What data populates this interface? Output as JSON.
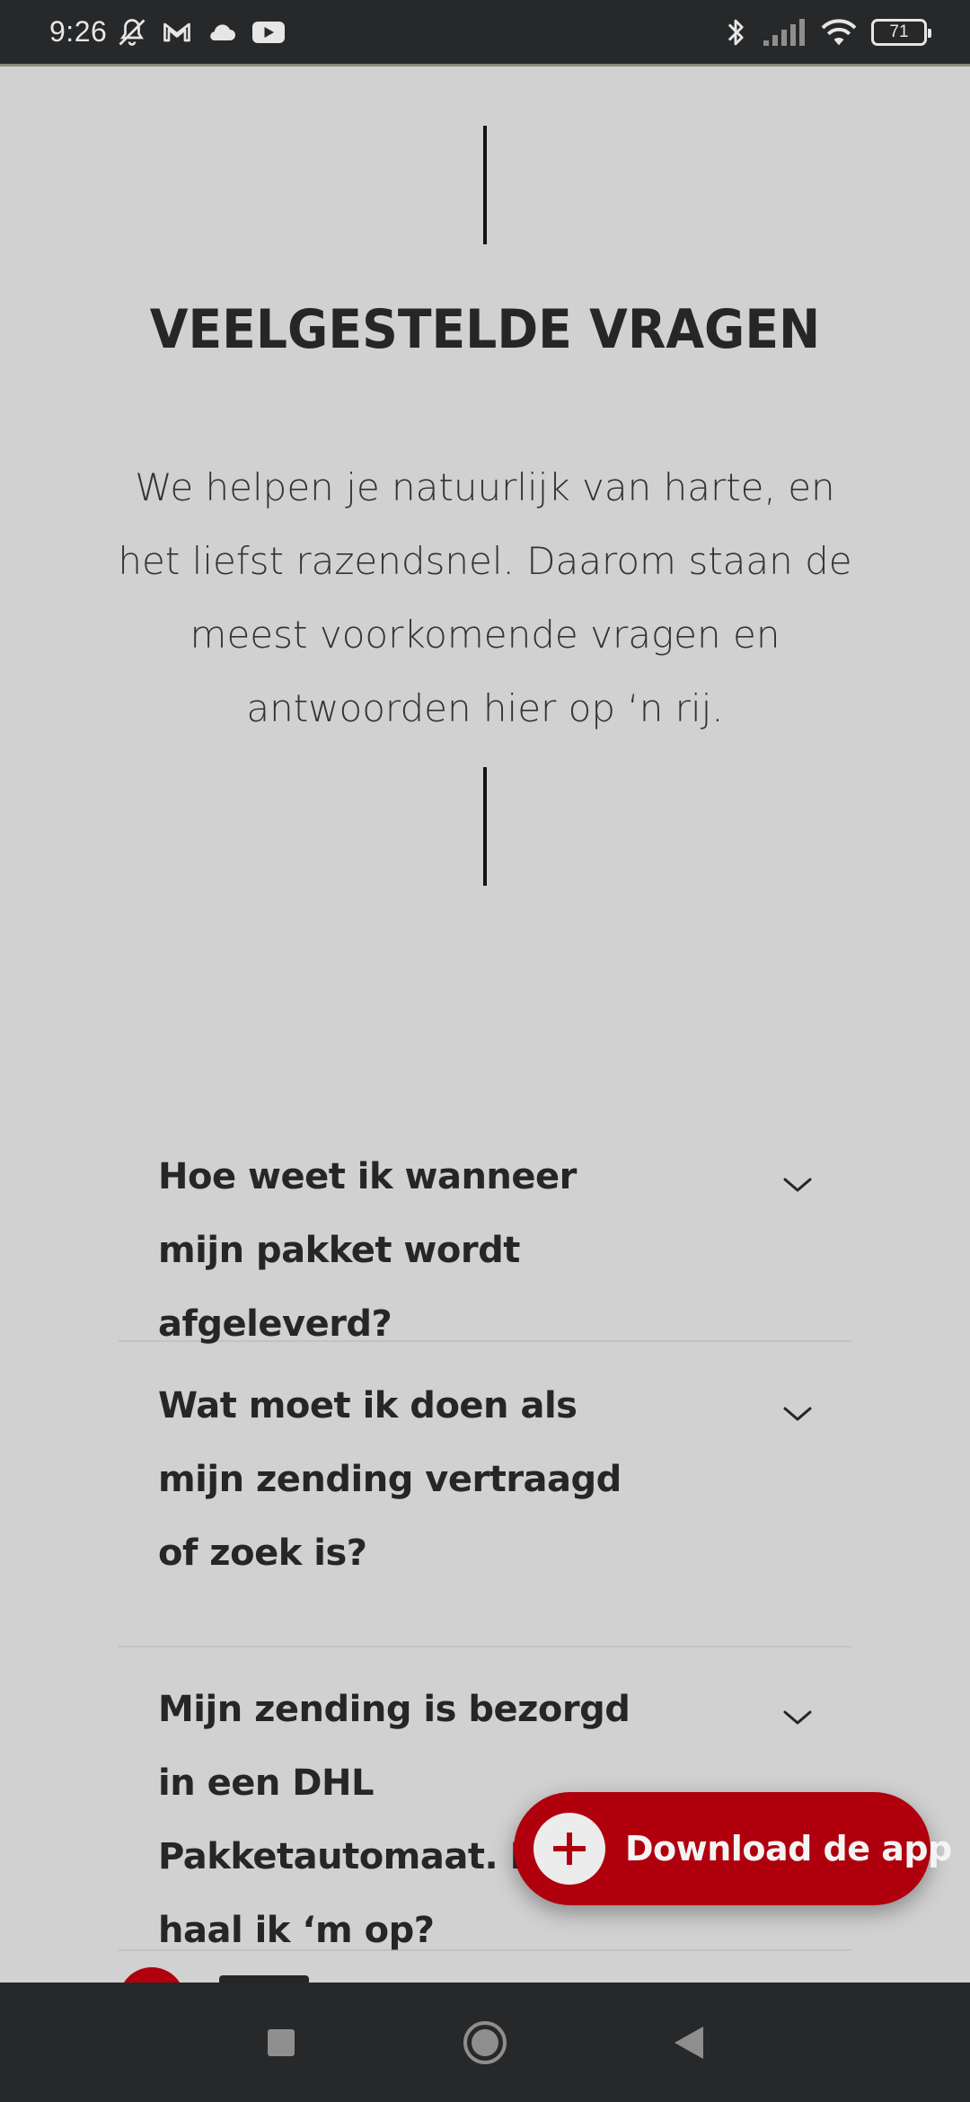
{
  "status_bar": {
    "time": "9:26",
    "left_icons": [
      "bell-off-icon",
      "gmail-icon",
      "cloud-icon",
      "youtube-icon"
    ],
    "right_icons": [
      "bluetooth-icon",
      "signal-icon",
      "wifi-icon",
      "battery-icon"
    ],
    "battery_level": "71"
  },
  "faq": {
    "title": "VEELGESTELDE VRAGEN",
    "intro": "We helpen je natuurlijk van harte, en het liefst razendsnel. Daarom staan de meest voorkomende vragen en antwoorden hier op ‘n rij.",
    "items": [
      {
        "question": "Hoe weet ik wanneer mijn pakket wordt afgeleverd?"
      },
      {
        "question": "Wat moet ik doen als mijn zending vertraagd of zoek is?"
      },
      {
        "question": "Mijn zending is bezorgd in een DHL Pakketautomaat. Hoe haal ik ‘m op?"
      }
    ]
  },
  "download_button": {
    "label": "Download de app",
    "icon": "plus-icon"
  },
  "colors": {
    "brand_red": "#b0000e",
    "page_background": "#d1d1d1",
    "system_bar": "#27282a"
  },
  "nav_bar": {
    "buttons": [
      "recents-square-icon",
      "home-circle-icon",
      "back-triangle-icon"
    ]
  }
}
